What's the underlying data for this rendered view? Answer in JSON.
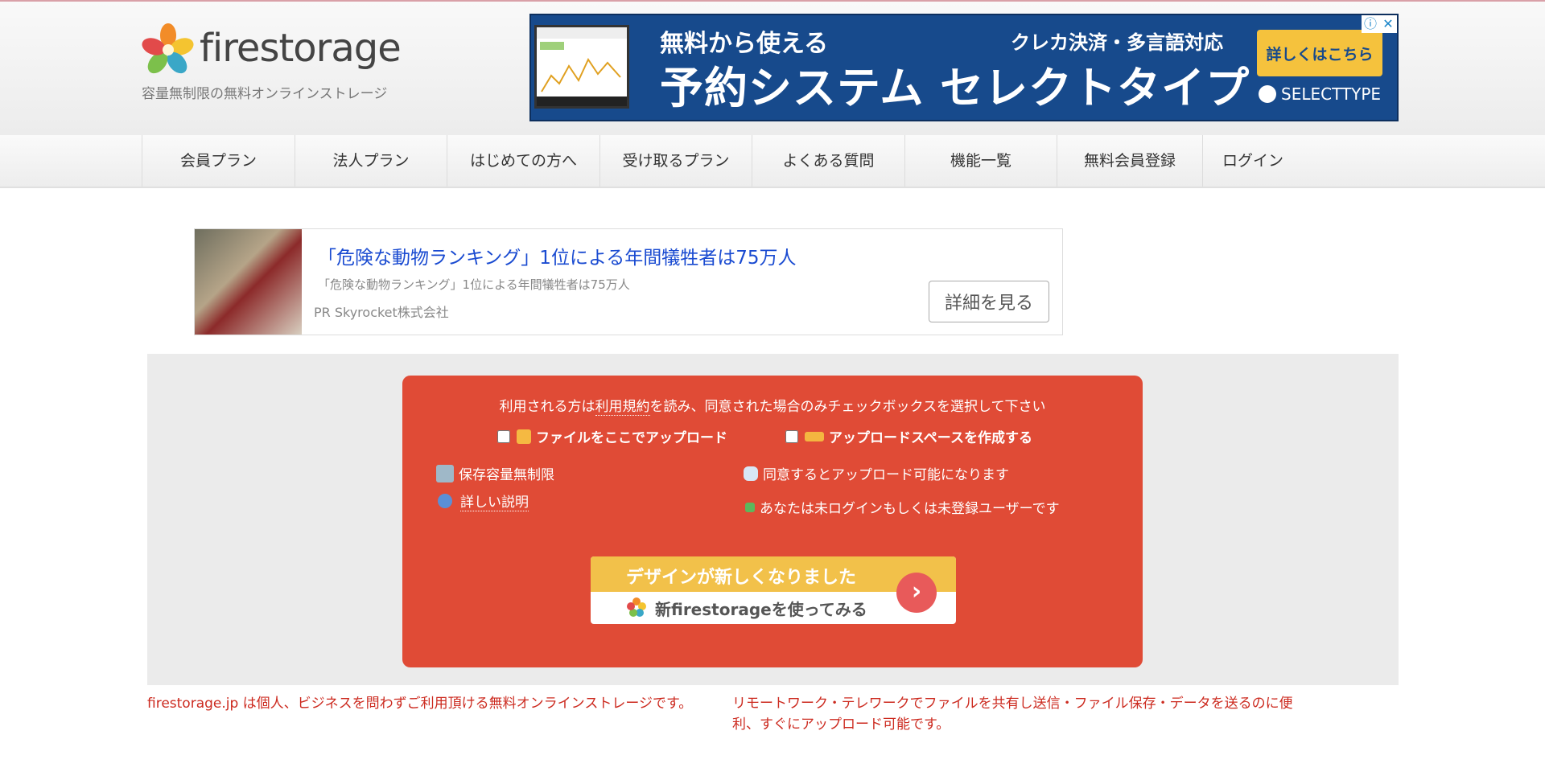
{
  "header": {
    "logo_text": "firestorage",
    "tagline": "容量無制限の無料オンラインストレージ"
  },
  "ad_banner": {
    "line1": "無料から使える",
    "line1b": "クレカ決済・多言語対応",
    "line2": "予約システム セレクトタイプ",
    "cta": "詳しくはこちら",
    "brand": "SELECTTYPE",
    "info_icon": "ⓘ",
    "close_icon": "✕"
  },
  "nav": {
    "items": [
      "会員プラン",
      "法人プラン",
      "はじめての方へ",
      "受け取るプラン",
      "よくある質問",
      "機能一覧",
      "無料会員登録",
      "ログイン"
    ]
  },
  "pr": {
    "title": "「危険な動物ランキング」1位による年間犠牲者は75万人",
    "subtitle": "「危険な動物ランキング」1位による年間犠牲者は75万人",
    "sponsor": "PR  Skyrocket株式会社",
    "button": "詳細を見る"
  },
  "upload": {
    "terms_prefix": "利用される方は",
    "terms_link": "利用規約",
    "terms_suffix": "を読み、同意された場合のみチェックボックスを選択して下さい",
    "option_upload": "ファイルをここでアップロード",
    "option_space": "アップロードスペースを作成する",
    "unlimited": "保存容量無制限",
    "details": "詳しい説明",
    "agree_note": "同意するとアップロード可能になります",
    "login_note": "あなたは未ログインもしくは未登録ユーザーです"
  },
  "promo": {
    "line1": "デザインが新しくなりました",
    "line2": "新firestorageを使ってみる",
    "arrow": "›"
  },
  "footer": {
    "left": "firestorage.jp は個人、ビジネスを問わずご利用頂ける無料オンラインストレージです。",
    "right_line1": "リモートワーク・テレワークでファイルを共有し送信・ファイル保存・データを送るのに便",
    "right_line2": "利、すぐにアップロード可能です。"
  }
}
